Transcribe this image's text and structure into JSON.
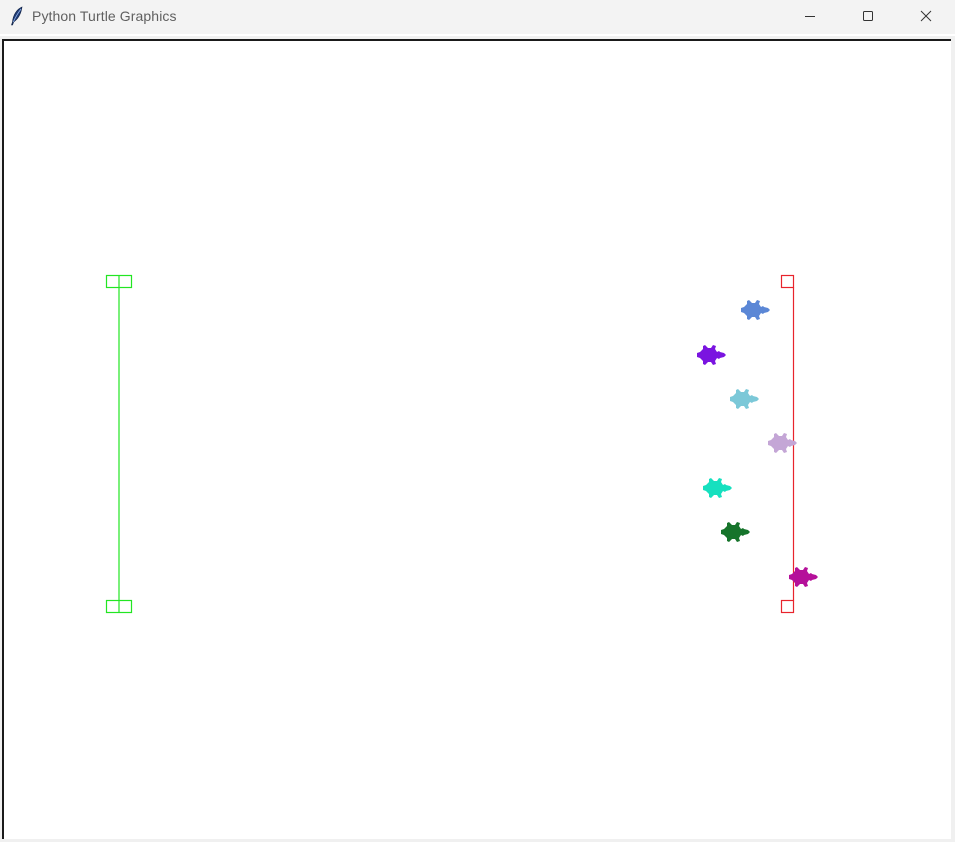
{
  "window": {
    "title": "Python Turtle Graphics",
    "app_icon": "feather-icon",
    "controls": {
      "minimize": "minimize-icon",
      "maximize": "maximize-icon",
      "close": "close-icon"
    }
  },
  "canvas": {
    "start_line_color": "#22e622",
    "finish_line_color": "#e8242c",
    "turtles": [
      {
        "color": "#5b87d6"
      },
      {
        "color": "#7a14e0"
      },
      {
        "color": "#7bc8d8"
      },
      {
        "color": "#c4a6d6"
      },
      {
        "color": "#16e0bf"
      },
      {
        "color": "#16742b"
      },
      {
        "color": "#b5109a"
      }
    ]
  }
}
